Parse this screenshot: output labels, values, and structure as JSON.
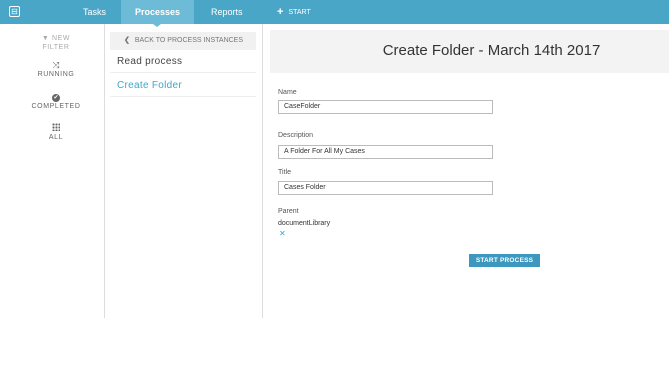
{
  "topbar": {
    "tasks": "Tasks",
    "processes": "Processes",
    "reports": "Reports",
    "start": "START",
    "start_plus": "+",
    "home_icon": "⊟"
  },
  "filters": {
    "new_filter_icon": "▼",
    "new_filter_line1": "NEW",
    "new_filter_line2": "FILTER",
    "running_icon": "⤨",
    "running": "RUNNING",
    "completed_icon": "✔",
    "completed": "COMPLETED",
    "all": "ALL"
  },
  "processes": {
    "back": "BACK TO PROCESS INSTANCES",
    "back_chev": "❮",
    "items": [
      {
        "label": "Read process"
      },
      {
        "label": "Create Folder"
      }
    ]
  },
  "form": {
    "title": "Create Folder - March 14th 2017",
    "name_label": "Name",
    "name_value": "CaseFolder",
    "description_label": "Description",
    "description_value": "A Folder For All My Cases",
    "title_label": "Title",
    "title_value": "Cases Folder",
    "parent_label": "Parent",
    "parent_value": "documentLibrary",
    "remove_icon": "✕",
    "start_button": "START PROCESS"
  },
  "colors": {
    "topbar": "#4aa6c7",
    "active_tab": "#6dbbd6",
    "accent": "#3ba8cb",
    "button": "#3d98bf"
  }
}
